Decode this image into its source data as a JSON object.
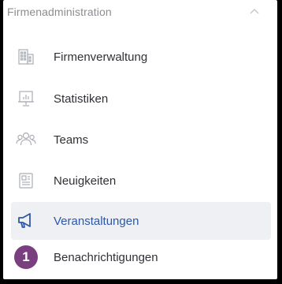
{
  "section": {
    "title": "Firmenadministration",
    "collapse_icon": "chevron-up-icon"
  },
  "items": [
    {
      "label": "Firmenverwaltung",
      "icon": "building-icon",
      "active": false
    },
    {
      "label": "Statistiken",
      "icon": "presentation-chart-icon",
      "active": false
    },
    {
      "label": "Teams",
      "icon": "people-group-icon",
      "active": false
    },
    {
      "label": "Neuigkeiten",
      "icon": "newspaper-icon",
      "active": false
    },
    {
      "label": "Veranstaltungen",
      "icon": "megaphone-icon",
      "active": true
    },
    {
      "label": "Benachrichtigungen",
      "icon": "bell-icon",
      "active": false
    }
  ],
  "badge": {
    "number": "1"
  },
  "colors": {
    "accent": "#2e57a8",
    "badge": "#7a3f7f",
    "icon_gray": "#a9adb4",
    "active_bg": "#eef0f4"
  }
}
